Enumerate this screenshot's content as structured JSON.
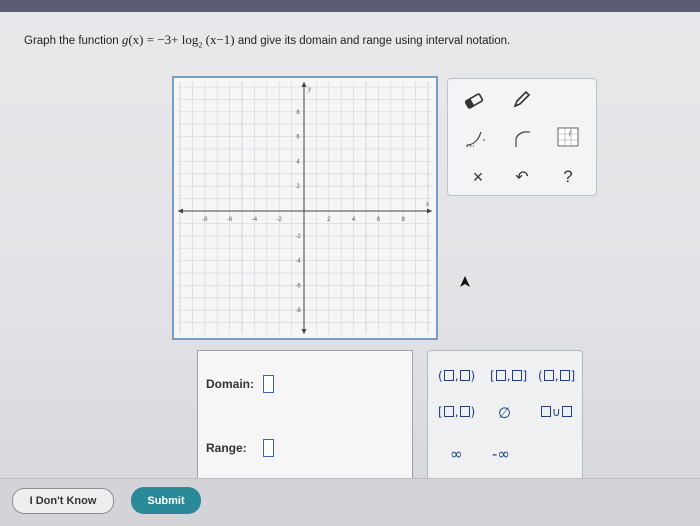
{
  "question": {
    "prefix": "Graph the function",
    "function_lhs": "g",
    "function_arg": "(x)",
    "function_eq": "=",
    "function_const": "−3+",
    "log_base_text": "log",
    "log_base": "2",
    "log_arg": "(x−1)",
    "suffix": "and give its domain and range using interval notation."
  },
  "graph": {
    "x_label": "x",
    "y_label": "y",
    "x_ticks": [
      "-8",
      "-6",
      "-4",
      "-2",
      "2",
      "4",
      "6",
      "8"
    ],
    "y_ticks_pos": [
      "8",
      "6",
      "4",
      "2"
    ],
    "y_ticks_neg": [
      "-2",
      "-4",
      "-6",
      "-8"
    ]
  },
  "tools": {
    "eraser": "eraser-icon",
    "pencil": "pencil-icon",
    "log_curve": "logarithm-curve-tool-icon",
    "asymptote": "asymptote-tool-icon",
    "grid_tool": "grid-fx-tool-icon",
    "clear_label": "×",
    "undo_label": "↶",
    "help_label": "?"
  },
  "answers": {
    "domain_label": "Domain:",
    "range_label": "Range:",
    "domain_value": "",
    "range_value": ""
  },
  "palette": {
    "open_open": [
      "(",
      ",",
      ")"
    ],
    "closed_closed": [
      "[",
      ",",
      "]"
    ],
    "open_closed": [
      "(",
      ",",
      "]"
    ],
    "closed_open": [
      "[",
      ",",
      ")"
    ],
    "empty_set": "∅",
    "union": "∪",
    "infinity": "∞",
    "neg_infinity": "-∞"
  },
  "footer": {
    "dont_know_label": "I Don't Know",
    "submit_label": "Submit"
  },
  "colors": {
    "accent": "#2a8a98",
    "graph_border": "#7b9bc4",
    "input_border": "#3b64b5",
    "topbar": "#5b5d75"
  }
}
